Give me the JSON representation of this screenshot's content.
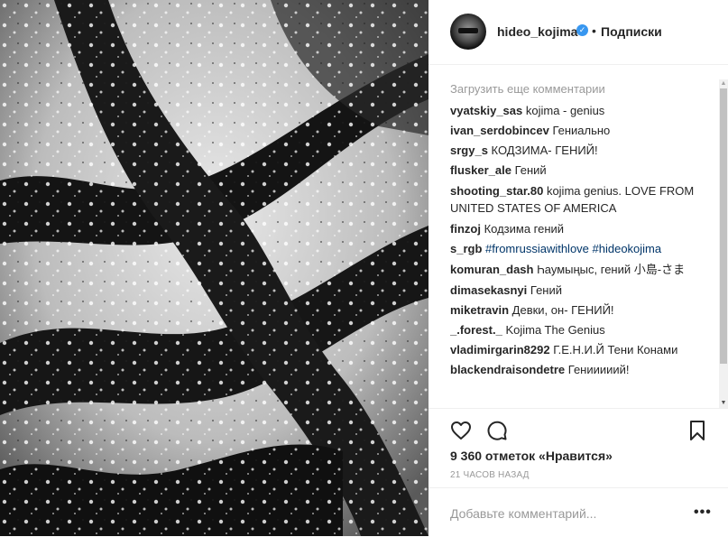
{
  "post": {
    "username": "hideo_kojima",
    "separator": "•",
    "follow_label": "Подписки",
    "verified_icon": "verified-badge-icon"
  },
  "comments": {
    "load_more": "Загрузить еще комментарии",
    "items": [
      {
        "user": "vyatskiy_sas",
        "text": "kojima - genius"
      },
      {
        "user": "ivan_serdobincev",
        "text": "Гениально"
      },
      {
        "user": "srgy_s",
        "text": "КОДЗИМА- ГЕНИЙ!"
      },
      {
        "user": "flusker_ale",
        "text": "Гений"
      },
      {
        "user": "shooting_star.80",
        "text": "kojima genius. LOVE FROM UNITED STATES OF AMERICA"
      },
      {
        "user": "finzoj",
        "text": "Кодзима гений"
      },
      {
        "user": "s_rgb",
        "text": "#fromrussiawithlove #hideokojima"
      },
      {
        "user": "komuran_dash",
        "text": "Һаумыңыс, гений 小島-さま"
      },
      {
        "user": "dimasekasnyi",
        "text": "Гений"
      },
      {
        "user": "miketravin",
        "text": "Девки, он- ГЕНИЙ!"
      },
      {
        "user": "_.forest._",
        "text": "Kojima The Genius"
      },
      {
        "user": "vladimirgarin8292",
        "text": "Г.Е.Н.И.Й Тени Конами"
      },
      {
        "user": "blackendraisondetre",
        "text": "Генииииий!"
      }
    ]
  },
  "actions": {
    "like_icon": "heart-icon",
    "comment_icon": "comment-bubble-icon",
    "save_icon": "bookmark-icon"
  },
  "likes": "9 360 отметок «Нравится»",
  "time": "21 ЧАСОВ НАЗАД",
  "add_comment": {
    "placeholder": "Добавьте комментарий...",
    "more_label": "•••"
  },
  "colors": {
    "link": "#003569",
    "muted": "#999999",
    "verified": "#3897f0",
    "text": "#262626"
  }
}
